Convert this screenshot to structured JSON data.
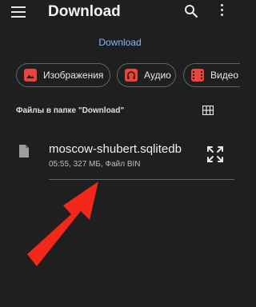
{
  "appbar": {
    "title": "Download",
    "menu_icon": "hamburger-menu-icon",
    "search_icon": "search-icon",
    "more_icon": "more-vert-icon"
  },
  "breadcrumb": {
    "label": "Download"
  },
  "filters": [
    {
      "label": "Изображения",
      "icon": "image-icon"
    },
    {
      "label": "Аудио",
      "icon": "headphones-icon"
    },
    {
      "label": "Видео",
      "icon": "film-icon"
    }
  ],
  "section": {
    "label": "Файлы в папке \"Download\"",
    "view_icon": "grid-view-icon"
  },
  "files": [
    {
      "name": "moscow-shubert.sqlitedb",
      "meta": "05:55, 327 МБ, Файл BIN",
      "icon": "document-icon",
      "action_icon": "expand-icon"
    }
  ],
  "colors": {
    "background": "#1f1f1f",
    "accent": "#8ab4f8",
    "chip_icon": "#e8453c",
    "arrow": "#f2281b"
  }
}
